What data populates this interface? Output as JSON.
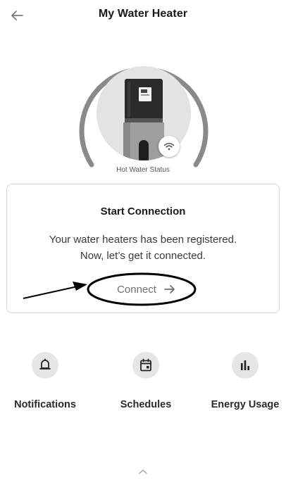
{
  "header": {
    "title": "My Water Heater",
    "back_icon": "arrow-left-icon"
  },
  "status": {
    "label": "Hot Water Status",
    "ring_color": "#8a8a8a",
    "wifi_icon": "wifi-icon"
  },
  "card": {
    "title": "Start Connection",
    "line1": "Your water heaters has been registered.",
    "line2": "Now, let’s get it connected.",
    "connect_label": "Connect",
    "connect_icon": "arrow-right-icon"
  },
  "actions": [
    {
      "label": "Notifications",
      "icon": "bell-icon"
    },
    {
      "label": "Schedules",
      "icon": "calendar-icon"
    },
    {
      "label": "Energy Usage",
      "icon": "bar-chart-icon"
    }
  ],
  "footer": {
    "expand_icon": "chevron-up-icon"
  }
}
